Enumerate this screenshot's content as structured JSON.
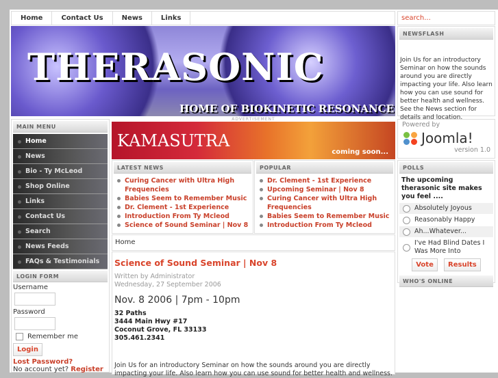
{
  "nav": [
    "Home",
    "Contact Us",
    "News",
    "Links"
  ],
  "search": {
    "placeholder": "search..."
  },
  "banner": {
    "title": "THERASONIC",
    "subtitle": "HOME OF BIOKINETIC RESONANCE"
  },
  "newsflash": {
    "title": "NEWSFLASH",
    "text": "Join Us for an introductory Seminar on how the sounds around you are directly impacting your life.  Also learn how you can use sound for better health and wellness. See the News section for details and location."
  },
  "main_menu": {
    "title": "MAIN MENU",
    "items": [
      "Home",
      "News",
      "Bio - Ty McLeod",
      "Shop Online",
      "Links",
      "Contact Us",
      "Search",
      "News Feeds",
      "FAQs & Testimonials"
    ]
  },
  "login": {
    "title": "LOGIN FORM",
    "username": "Username",
    "password": "Password",
    "remember": "Remember me",
    "button": "Login",
    "lost": "Lost Password?",
    "no_account": "No account yet?",
    "register": "Register"
  },
  "ad": {
    "label": "ADVERTISEMENT",
    "brand": "KAMASUTRA",
    "tagline": "coming soon..."
  },
  "latest": {
    "title": "LATEST NEWS",
    "items": [
      "Curing Cancer with Ultra High Frequencies",
      "Babies Seem to Remember Music",
      "Dr. Clement - 1st Experience",
      "Introduction From Ty Mcleod",
      "Science of Sound Seminar | Nov 8"
    ]
  },
  "popular": {
    "title": "POPULAR",
    "items": [
      "Dr. Clement - 1st Experience",
      "Upcoming Seminar | Nov 8",
      "Curing Cancer with Ultra High Frequencies",
      "Babies Seem to Remember Music",
      "Introduction From Ty Mcleod"
    ]
  },
  "breadcrumb": "Home",
  "article": {
    "title": "Science of Sound Seminar | Nov 8",
    "author": "Written by Administrator",
    "date": "Wednesday, 27 September 2006",
    "headline": "Nov. 8 2006 | 7pm - 10pm",
    "address": [
      "32 Paths",
      "3444 Main Hwy #17",
      "Coconut Grove, FL  33133",
      "305.461.2341"
    ],
    "body": "Join Us for an introductory Seminar on how the sounds around you are directly impacting your life.  Also learn how you can use sound for better health and wellness."
  },
  "powered": {
    "label": "Powered by",
    "brand": "Joomla!",
    "version": "version 1.0"
  },
  "polls": {
    "title": "POLLS",
    "question": "The upcoming therasonic site makes you feel ....",
    "options": [
      "Absolutely Joyous",
      "Reasonably Happy",
      "Ah...Whatever...",
      "I've Had Blind Dates I Was More Into"
    ],
    "vote": "Vote",
    "results": "Results"
  },
  "whos_online": {
    "title": "WHO'S ONLINE"
  }
}
